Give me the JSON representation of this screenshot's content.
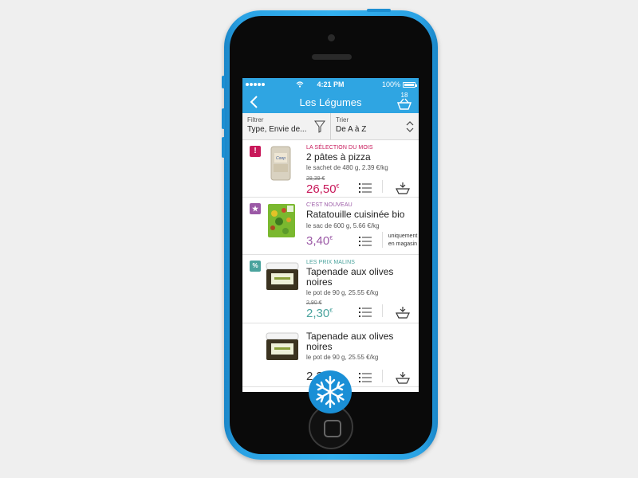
{
  "status": {
    "carrier_dots": 5,
    "time": "4:21 PM",
    "battery": "100%"
  },
  "nav": {
    "title": "Les Légumes",
    "cart_count": "18"
  },
  "filter": {
    "label": "Filtrer",
    "value": "Type, Envie de..."
  },
  "sort": {
    "label": "Trier",
    "value": "De A à Z"
  },
  "colors": {
    "primary": "#2fa5e2",
    "selection": "#c8185a",
    "nouveau": "#9b59a6",
    "malins": "#4aa39d"
  },
  "products": [
    {
      "badge_icon": "exclamation-icon",
      "badge_text": "!",
      "tag": "LA SÉLECTION DU MOIS",
      "name": "2 pâtes à pizza",
      "desc": "le sachet de 480 g, 2.39 €/kg",
      "old_price": "28,39 €",
      "price": "26,50",
      "currency": "€"
    },
    {
      "badge_icon": "star-icon",
      "badge_text": "★",
      "tag": "C'EST NOUVEAU",
      "name": "Ratatouille cuisinée bio",
      "desc": "le sac de 600 g, 5.66 €/kg",
      "price": "3,40",
      "currency": "€",
      "store_only": "uniquement en magasin"
    },
    {
      "badge_icon": "percent-icon",
      "badge_text": "%",
      "tag": "LES PRIX MALINS",
      "name": "Tapenade aux olives noires",
      "desc": "le pot de 90 g, 25.55 €/kg",
      "old_price": "2,90 €",
      "price": "2,30",
      "currency": "€"
    },
    {
      "name": "Tapenade aux olives noires",
      "desc": "le pot de 90 g, 25.55 €/kg",
      "price": "2,30",
      "currency": "€"
    }
  ]
}
